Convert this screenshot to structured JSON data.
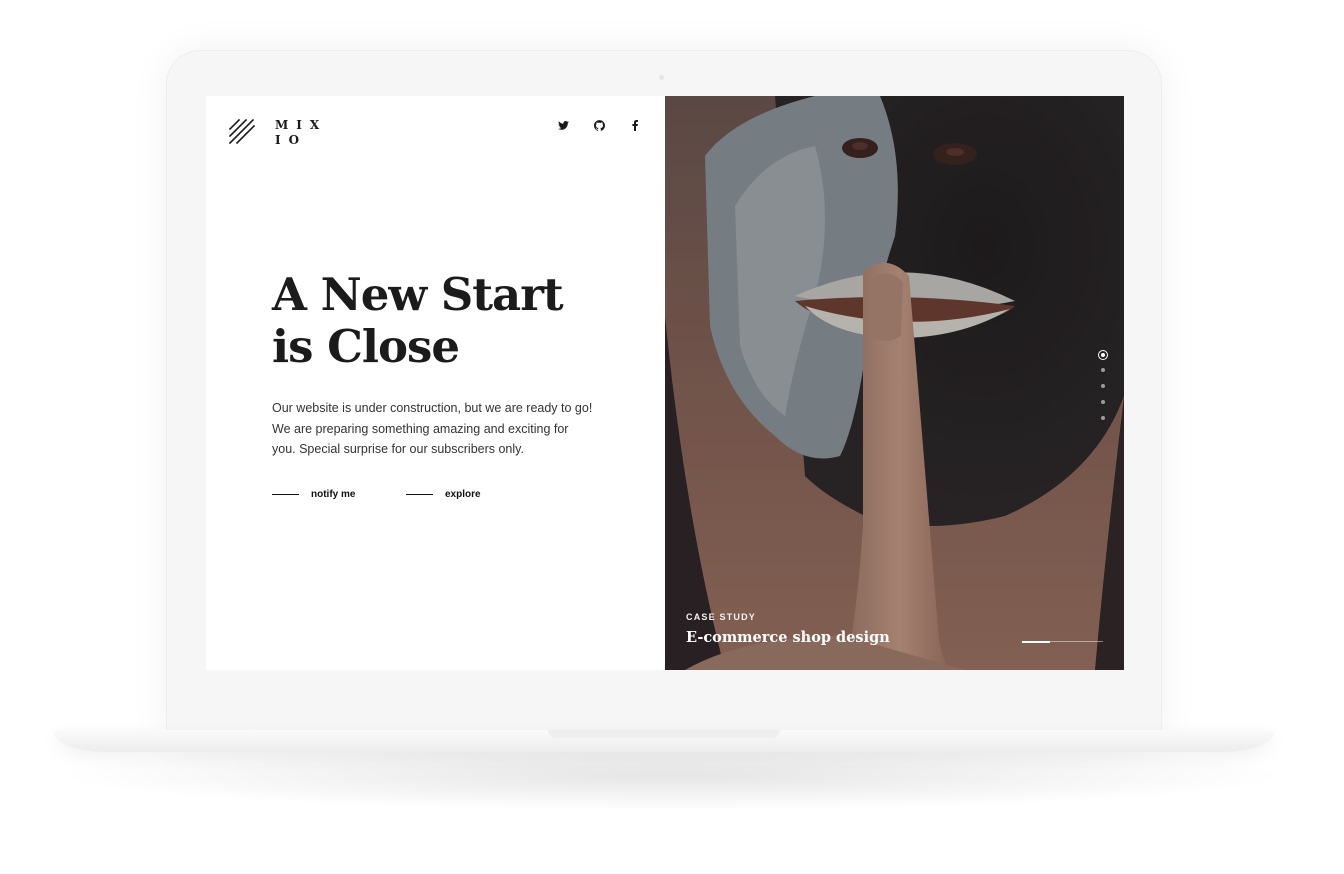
{
  "brand": {
    "logo_line1": "MIX",
    "logo_line2": "IO",
    "logo_icon": "diagonal-stripes-icon"
  },
  "social_links": [
    {
      "icon": "twitter-icon"
    },
    {
      "icon": "github-icon"
    },
    {
      "icon": "facebook-icon"
    }
  ],
  "hero": {
    "headline_line1": "A New Start",
    "headline_line2": "is Close",
    "description_lines": [
      "Our website is under construction, but we are ready to go!",
      "We are preparing something amazing and exciting for",
      "you. Special surprise for our subscribers only."
    ],
    "primary_cta": "notify me",
    "secondary_cta": "explore"
  },
  "slider": {
    "case_label": "CASE STUDY",
    "case_title": "E-commerce shop design",
    "slide_count": 5,
    "active_slide": 1,
    "progress": 0.35
  },
  "colors": {
    "text_dark": "#1b1b1b",
    "panel_bg": "#ffffff",
    "photo_overlay": "#140f0f",
    "device_frame": "#f6f6f6"
  }
}
